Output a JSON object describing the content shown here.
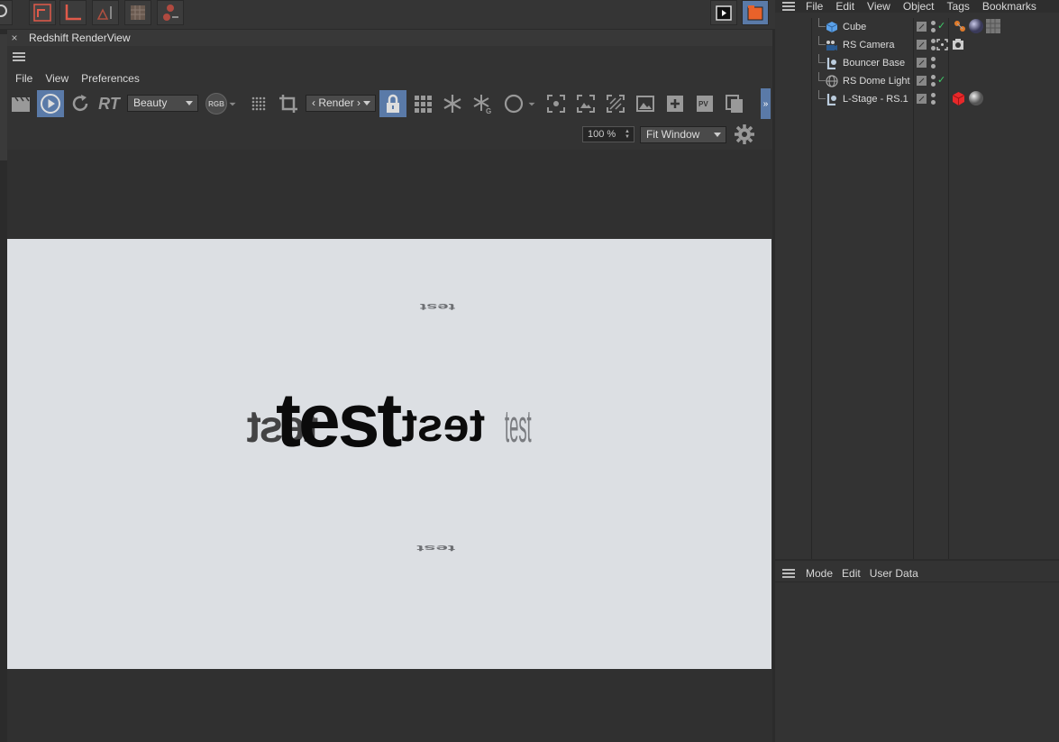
{
  "render_view": {
    "title": "Redshift RenderView",
    "close_glyph": "×",
    "menu": [
      "File",
      "View",
      "Preferences"
    ],
    "aov_dropdown": "Beauty",
    "rgb_label": "RGB",
    "rt_label": "RT",
    "render_dropdown": "‹ Render ›",
    "zoom_value": "100 %",
    "fit_dropdown": "Fit Window",
    "canvas_text": "test",
    "colors": {
      "accent": "#5a7aa8",
      "canvas_bg": "#dcdfe3"
    }
  },
  "object_manager": {
    "menu": [
      "File",
      "Edit",
      "View",
      "Object",
      "Tags",
      "Bookmarks"
    ],
    "objects": [
      {
        "label": "Cube",
        "icon": "cube-icon"
      },
      {
        "label": "RS Camera",
        "icon": "camera-icon"
      },
      {
        "label": "Bouncer Base",
        "icon": "light-icon"
      },
      {
        "label": "RS Dome Light",
        "icon": "dome-light-icon"
      },
      {
        "label": "L-Stage - RS.1",
        "icon": "light-icon"
      }
    ]
  },
  "attribute_manager": {
    "menu": [
      "Mode",
      "Edit",
      "User Data"
    ]
  }
}
